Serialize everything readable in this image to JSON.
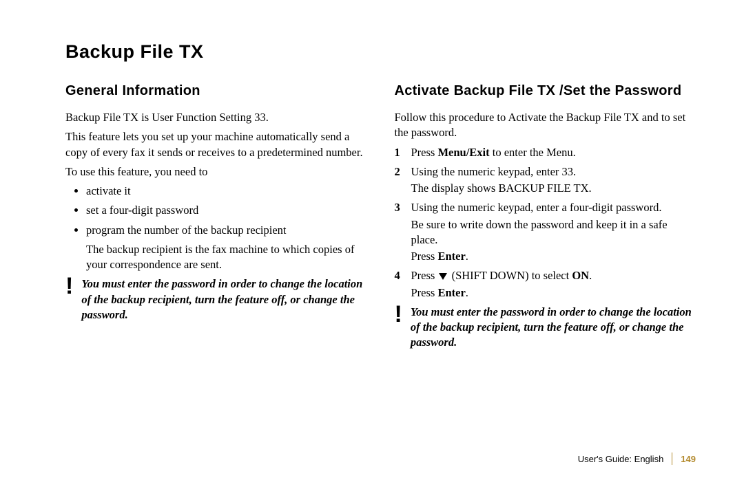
{
  "title": "Backup File TX",
  "left": {
    "heading": "General Information",
    "p1": "Backup File TX is User Function Setting 33.",
    "p2": "This feature lets you set up your machine automatically send a copy of every fax it sends or receives to a predetermined number.",
    "p3": "To use this feature, you need to",
    "bullets": [
      "activate it",
      "set a four-digit password",
      "program the number of the backup recipient"
    ],
    "sub": "The backup recipient is the fax machine to which copies of your correspondence are sent.",
    "note": "You must enter the password in order to change the location of the backup recipient, turn the feature off, or change the password."
  },
  "right": {
    "heading": "Activate Backup File TX /Set the Password",
    "intro": "Follow this procedure to Activate the Backup File TX and to set the password.",
    "s1a": "Press ",
    "s1b": "Menu/Exit",
    "s1c": " to enter the Menu.",
    "s2a": "Using the numeric keypad, enter 33.",
    "s2b": "The display shows BACKUP FILE TX.",
    "s3a": "Using the numeric keypad, enter a four-digit password.",
    "s3b": "Be sure to write down the password and keep it in a safe place.",
    "s3c1": "Press ",
    "s3c2": "Enter",
    "s3c3": ".",
    "s4a": "Press  ",
    "s4b": " (SHIFT DOWN) to select ",
    "s4c": "ON",
    "s4d": ".",
    "s4e1": "Press ",
    "s4e2": "Enter",
    "s4e3": ".",
    "note": "You must enter the password in order to change the location of the backup recipient, turn the feature off, or change the password."
  },
  "footer": {
    "guide": "User's Guide:  English",
    "page": "149"
  }
}
